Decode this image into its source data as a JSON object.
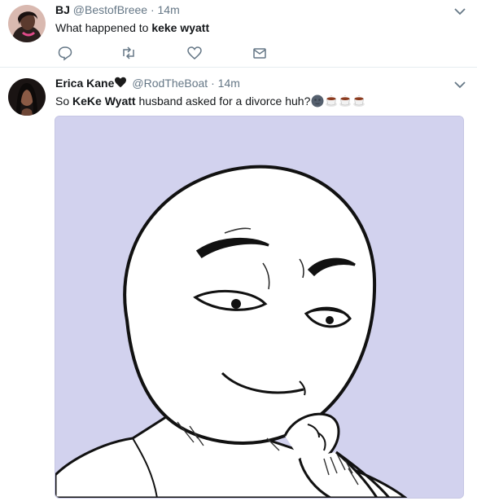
{
  "tweets": [
    {
      "name": "BJ",
      "handle": "@BestofBreee",
      "dot": "·",
      "time": "14m",
      "text_prefix": "What happened to ",
      "text_bold": "keke wyatt",
      "actions": [
        "reply-icon",
        "retweet-icon",
        "like-icon",
        "message-icon"
      ]
    },
    {
      "name": "Erica Kane",
      "handle": "@RodTheBoat",
      "dot": "·",
      "time": "14m",
      "text_prefix": "So ",
      "text_bold": "KeKe Wyatt",
      "text_suffix": " husband asked for a divorce huh?",
      "name_emoji": "black-heart-icon",
      "text_emojis": [
        "new-moon-face-icon",
        "tea-cup-icon",
        "tea-cup-icon",
        "tea-cup-icon"
      ],
      "media": "smug-meme-face-illustration"
    }
  ],
  "colors": {
    "secondary_text": "#657786",
    "icon": "#657786",
    "divider": "#e6ecf0",
    "media_bg": "#d2d2ee"
  }
}
